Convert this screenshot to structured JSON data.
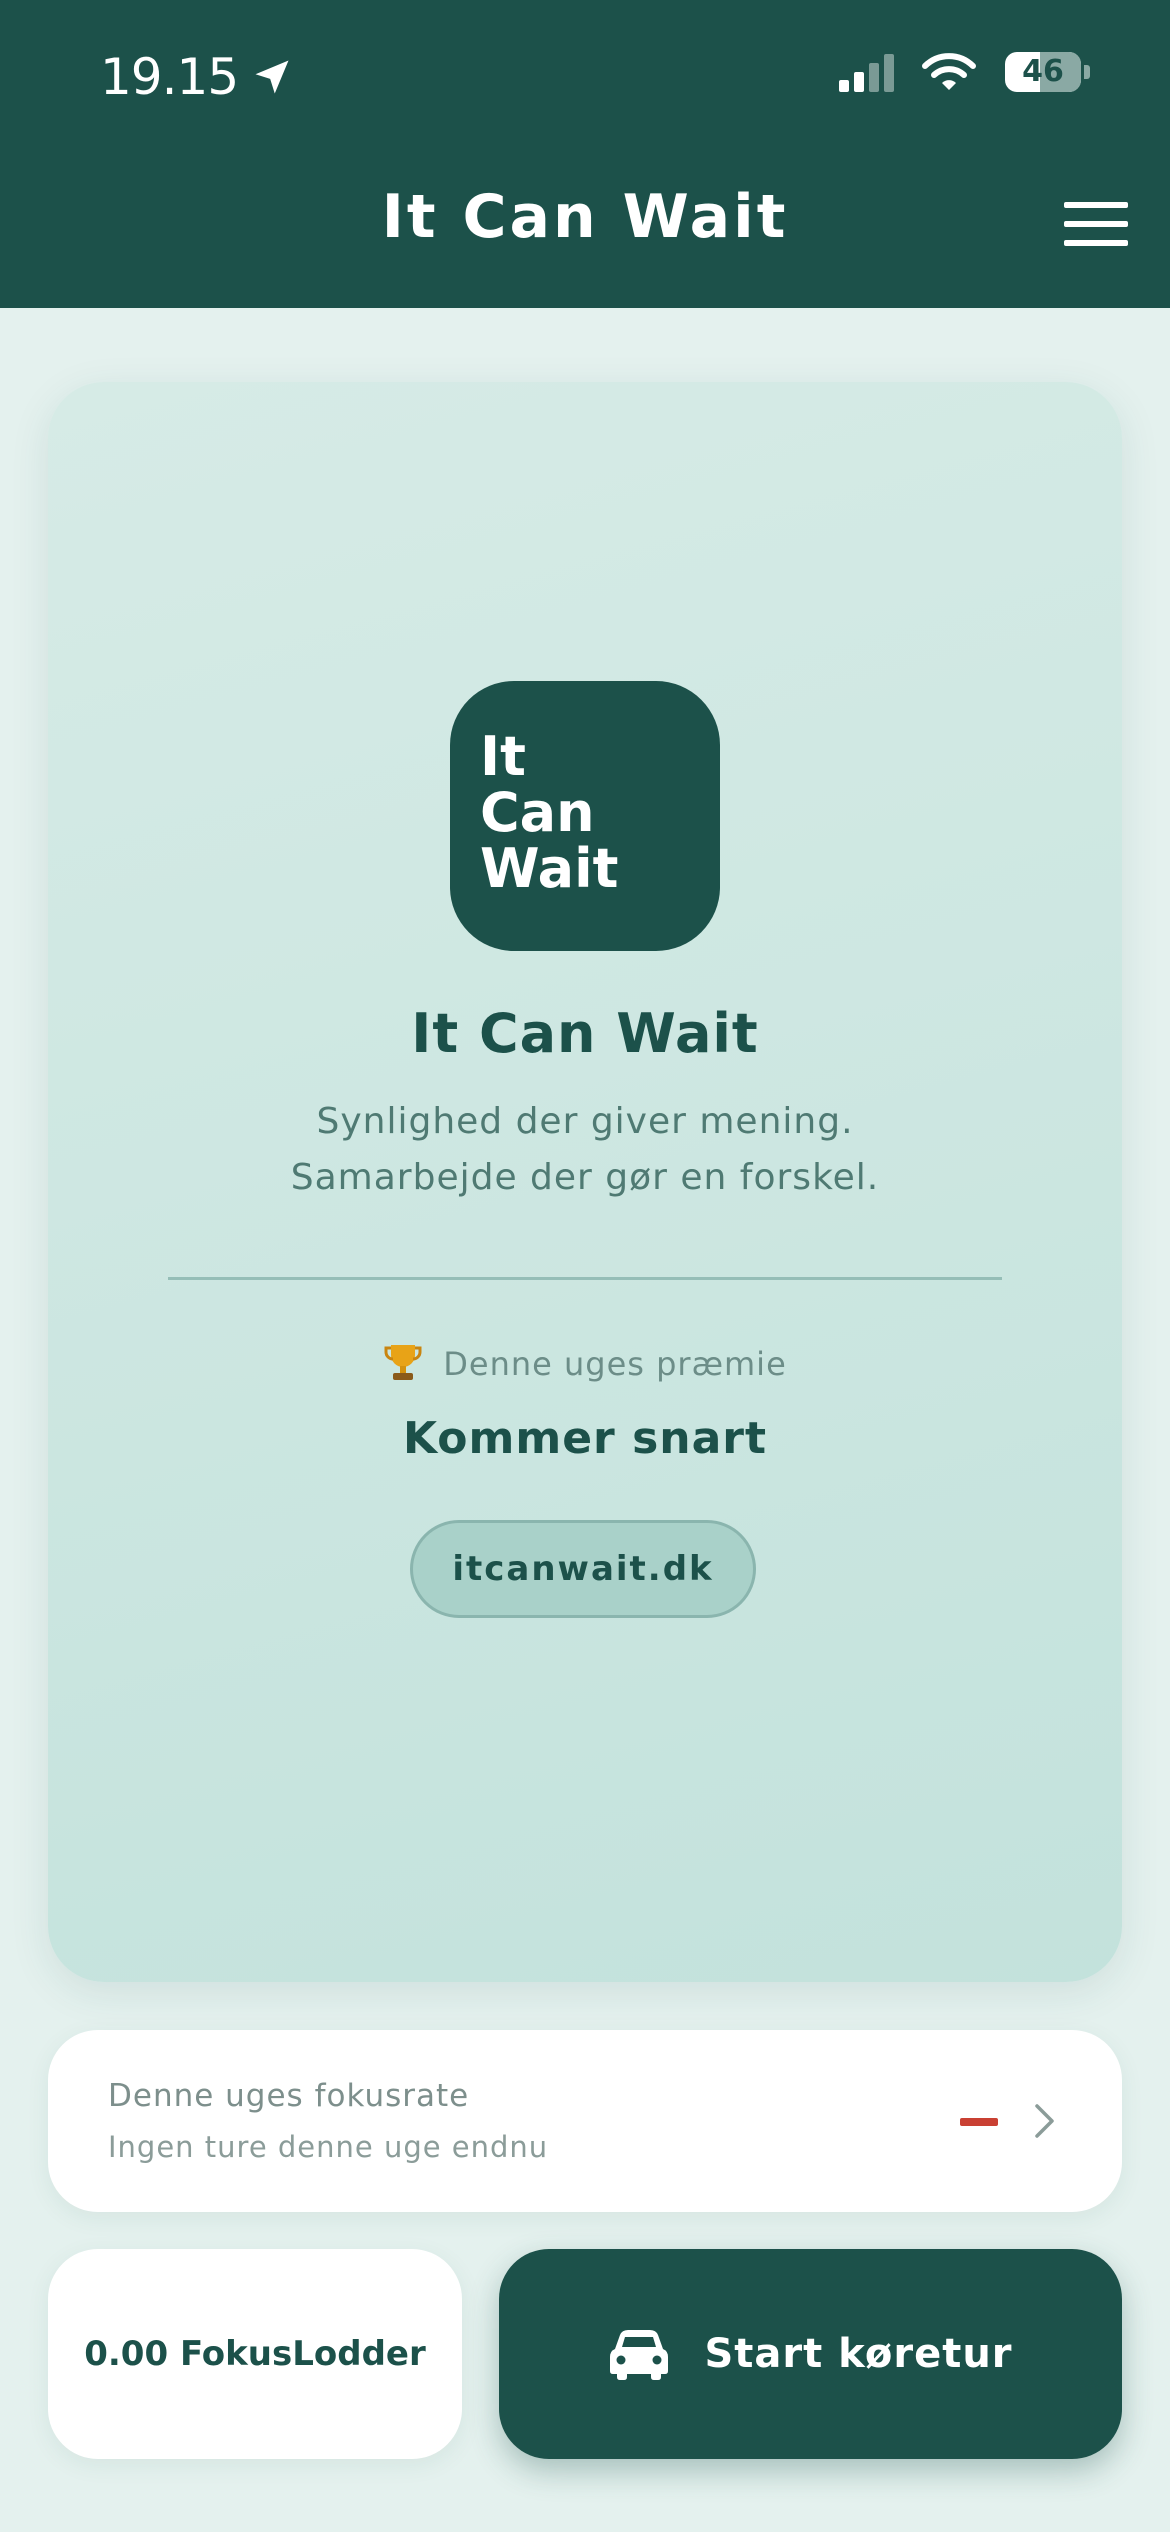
{
  "status_bar": {
    "time": "19.15",
    "battery": "46",
    "battery_level_percent": 46,
    "icons": [
      "location-arrow-icon",
      "signal-icon",
      "wifi-icon",
      "battery-icon"
    ]
  },
  "header": {
    "title": "It Can Wait",
    "menu_icon": "hamburger-menu-icon"
  },
  "hero": {
    "logo_lines": [
      "It",
      "Can",
      "Wait"
    ],
    "title": "It Can Wait",
    "tagline_line1": "Synlighed der giver mening.",
    "tagline_line2": "Samarbejde der gør en forskel.",
    "prize_icon": "trophy-icon",
    "prize_label": "Denne uges præmie",
    "prize_value": "Kommer snart",
    "website": "itcanwait.dk"
  },
  "focus": {
    "title": "Denne uges fokusrate",
    "subtitle": "Ingen ture denne uge endnu",
    "value": "–",
    "chevron_icon": "chevron-right-icon"
  },
  "bottom": {
    "lodder_label": "0.00 FokusLodder",
    "start_label": "Start køretur",
    "start_icon": "car-icon"
  },
  "colors": {
    "brand_dark": "#1c514a",
    "card_bg": "#d6ebe6",
    "page_bg": "#e4f1ee",
    "accent_red": "#c94033",
    "pill_bg": "#a9d1c9"
  }
}
